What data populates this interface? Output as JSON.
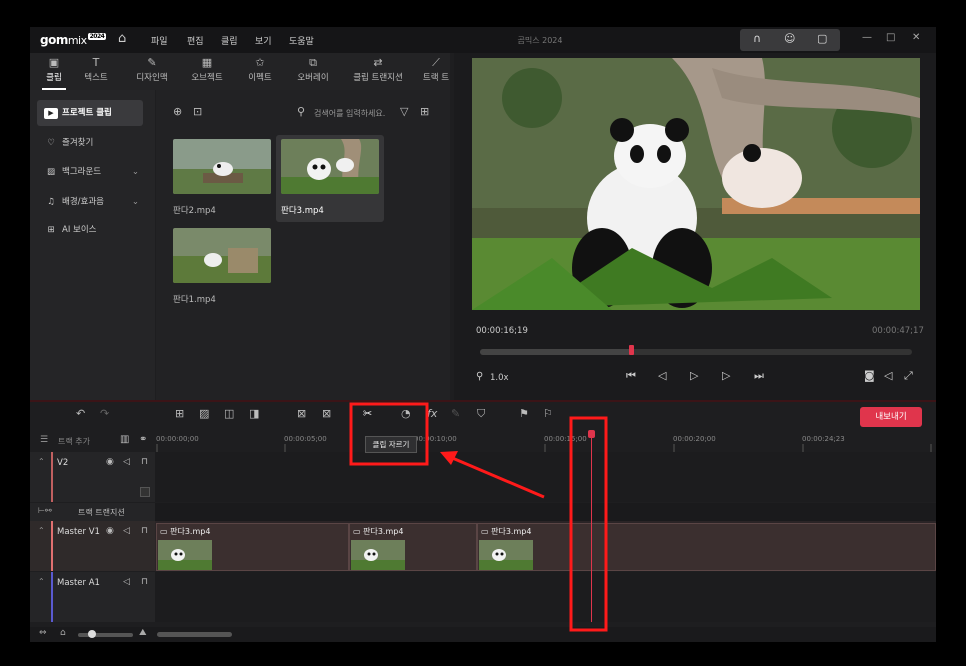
{
  "app": {
    "logo_text": "gom",
    "logo_sub": "mix",
    "logo_badge": "2024",
    "window_title": "곰믹스 2024"
  },
  "menu": [
    "파일",
    "편집",
    "클립",
    "보기",
    "도움말"
  ],
  "tabs": [
    {
      "label": "클립",
      "icon": "clip-icon",
      "glyph": "▣"
    },
    {
      "label": "텍스트",
      "icon": "text-icon",
      "glyph": "T"
    },
    {
      "label": "디자인맥",
      "icon": "design-icon",
      "glyph": "✎"
    },
    {
      "label": "오브젝트",
      "icon": "object-icon",
      "glyph": "▦"
    },
    {
      "label": "이펙트",
      "icon": "effect-icon",
      "glyph": "✩"
    },
    {
      "label": "오버레이",
      "icon": "overlay-icon",
      "glyph": "⧉"
    },
    {
      "label": "클립 트랜지션",
      "icon": "transition-icon",
      "glyph": "⇄"
    },
    {
      "label": "트랙 트",
      "icon": "track-transition-icon",
      "glyph": "⟋"
    }
  ],
  "sidebar": [
    {
      "label": "프로젝트 클립",
      "icon": "project-clip-icon",
      "glyph": "▶",
      "active": true
    },
    {
      "label": "즐겨찾기",
      "icon": "heart-icon",
      "glyph": "♡"
    },
    {
      "label": "백그라운드",
      "icon": "background-icon",
      "glyph": "▨",
      "has_chevron": true
    },
    {
      "label": "배경/효과음",
      "icon": "music-icon",
      "glyph": "♫",
      "has_chevron": true
    },
    {
      "label": "AI 보이스",
      "icon": "ai-voice-icon",
      "glyph": "⊞"
    }
  ],
  "library": {
    "search_placeholder": "검색어를 입력하세요.",
    "clips": [
      {
        "name": "판다2.mp4"
      },
      {
        "name": "판다3.mp4",
        "selected": true
      },
      {
        "name": "판다1.mp4"
      }
    ]
  },
  "preview": {
    "current_time": "00:00:16;19",
    "total_time": "00:00:47;17",
    "zoom": "1.0x",
    "progress": 0.35
  },
  "timeline": {
    "export_label": "내보내기",
    "add_track_label": "트랙 추가",
    "tooltip": "클립 자르기",
    "ruler_labels": [
      "00:00:00;00",
      "00:00:05;00",
      "00:00:10;00",
      "00:00:15;00",
      "00:00:20;00",
      "00:00:24;23"
    ],
    "tracks": [
      {
        "name": "V2"
      },
      {
        "name": "트랙 트랜지션"
      },
      {
        "name": "Master V1"
      },
      {
        "name": "Master A1"
      }
    ],
    "clips": [
      {
        "name": "판다3.mp4"
      },
      {
        "name": "판다3.mp4"
      },
      {
        "name": "판다3.mp4"
      }
    ]
  },
  "colors": {
    "accent": "#e0354c",
    "annotation": "#ff1a1a"
  }
}
